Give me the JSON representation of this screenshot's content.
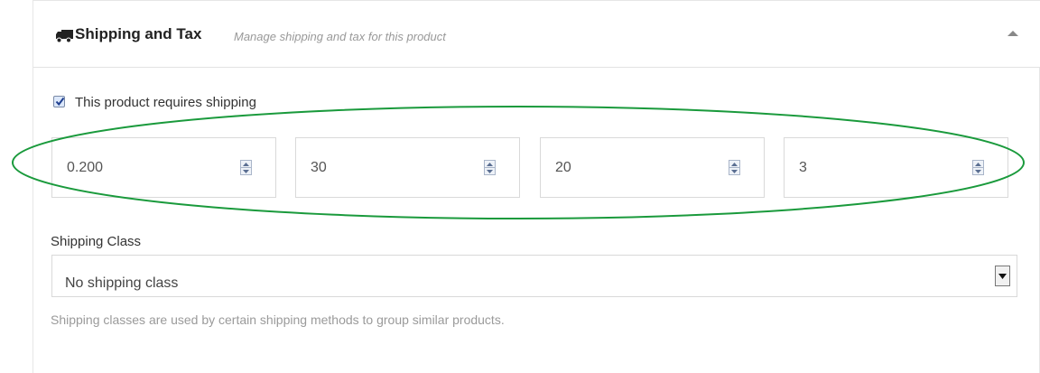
{
  "panel": {
    "title": "Shipping and Tax",
    "subtitle": "Manage shipping and tax for this product",
    "icon": "truck-icon",
    "collapse_icon": "caret-up-icon"
  },
  "requires_shipping": {
    "checked": true,
    "label": "This product requires shipping"
  },
  "dimensions": [
    {
      "value": "0.200"
    },
    {
      "value": "30"
    },
    {
      "value": "20"
    },
    {
      "value": "3"
    }
  ],
  "shipping_class": {
    "label": "Shipping Class",
    "selected": "No shipping class",
    "help": "Shipping classes are used by certain shipping methods to group similar products."
  },
  "colors": {
    "highlight": "#1a9a3c",
    "border": "#e3e3e3"
  }
}
